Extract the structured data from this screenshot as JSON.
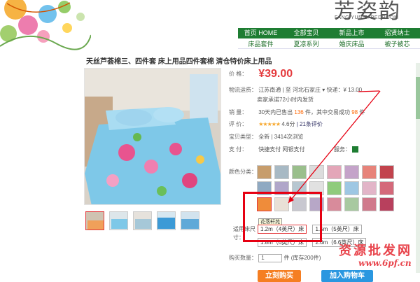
{
  "header": {
    "brand": "芳姿韵",
    "brand_sub": "FANG YUN ZI BEDROOM"
  },
  "nav_primary": [
    "首页 HOME",
    "全部宝贝",
    "新品上市",
    "招贤纳士"
  ],
  "nav_secondary": [
    "床品套件",
    "夏凉系列",
    "婚庆床品",
    "被子被芯"
  ],
  "product": {
    "title": "天丝芦荟棉三、四件套 床上用品四件套棉 清仓特价床上用品",
    "price_label": "价    格：",
    "price": "¥39.00",
    "shipping_label": "物流运费：",
    "shipping_value": "江苏南通 | 至  河北石家庄 ▾   快递：¥ 13.00",
    "promise": "卖家承诺72小时内发货",
    "sales_label": "销    量：",
    "sales_prefix": "30天内已售出",
    "sales_count": "136",
    "sales_mid": "件，其中交易成功",
    "sales_success": "98",
    "sales_suffix": "件",
    "review_label": "评    价：",
    "stars": "★★★★★",
    "rating": "4.6分",
    "reviews": "| 21条评价",
    "type_label": "宝贝类型：",
    "type_value": "全新  |  3414次浏览",
    "payment_label": "支    付：",
    "payment_value": "快捷支付  网银支付",
    "service_label": "服务：",
    "color_label": "颜色分类：",
    "tooltip": "花落轩苑",
    "size_label": "适用床尺寸：",
    "size_options": [
      "1.2m（4英尺）床",
      "1.5m（5英尺）床",
      "1.8m（6英尺）床",
      "2.0m（6.6英尺）床"
    ],
    "qty_label": "购买数量：",
    "qty_value": "1",
    "stock": "件 (库存200件)",
    "buy_button": "立刻购买",
    "cart_button": "加入购物车"
  },
  "watermark": {
    "text": "资源批发网",
    "url": "www.6pf.cn"
  },
  "colors": {
    "nav_green": "#1e7d32",
    "price_red": "#e4393c",
    "buy_orange": "#f57e22",
    "cart_blue": "#2a97e0",
    "highlight_red": "#e60012"
  }
}
